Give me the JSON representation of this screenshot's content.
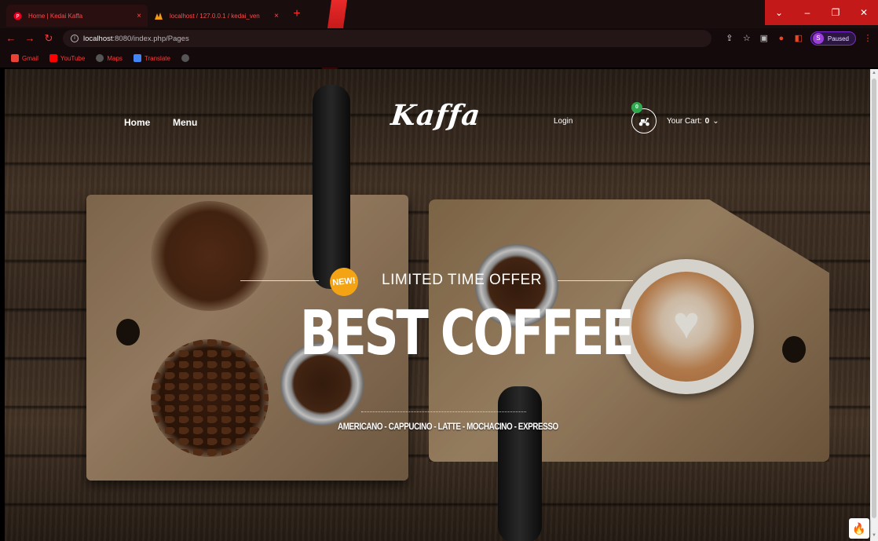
{
  "browser": {
    "tabs": [
      {
        "title": "Home | Kedai Kaffa",
        "close": "×"
      },
      {
        "title": "localhost / 127.0.0.1 / kedai_ven",
        "close": "×"
      }
    ],
    "new_tab": "+",
    "url_host": "localhost",
    "url_rest": ":8080/index.php/Pages",
    "profile_initial": "S",
    "profile_status": "Paused",
    "bookmarks": [
      {
        "label": "Gmail",
        "color": "#ea4335"
      },
      {
        "label": "YouTube",
        "color": "#ff0000"
      },
      {
        "label": "Maps",
        "color": "#34a853"
      },
      {
        "label": "Translate",
        "color": "#4285f4"
      }
    ]
  },
  "site": {
    "nav": {
      "home": "Home",
      "menu": "Menu"
    },
    "logo": "Kaffa",
    "login": "Login",
    "cart": {
      "badge": "0",
      "label": "Your Cart:",
      "count": "0",
      "caret": "⌄"
    }
  },
  "hero": {
    "badge": "NEW!",
    "offer": "LIMITED TIME OFFER",
    "title": "BEST COFFEE",
    "subtitle": "AMERICANO - CAPPUCINO - LATTE - MOCHACINO - EXPRESSO"
  },
  "colors": {
    "accent_badge": "#f3a313",
    "cart_badge": "#2fa84f",
    "chrome_red": "#c41919"
  }
}
